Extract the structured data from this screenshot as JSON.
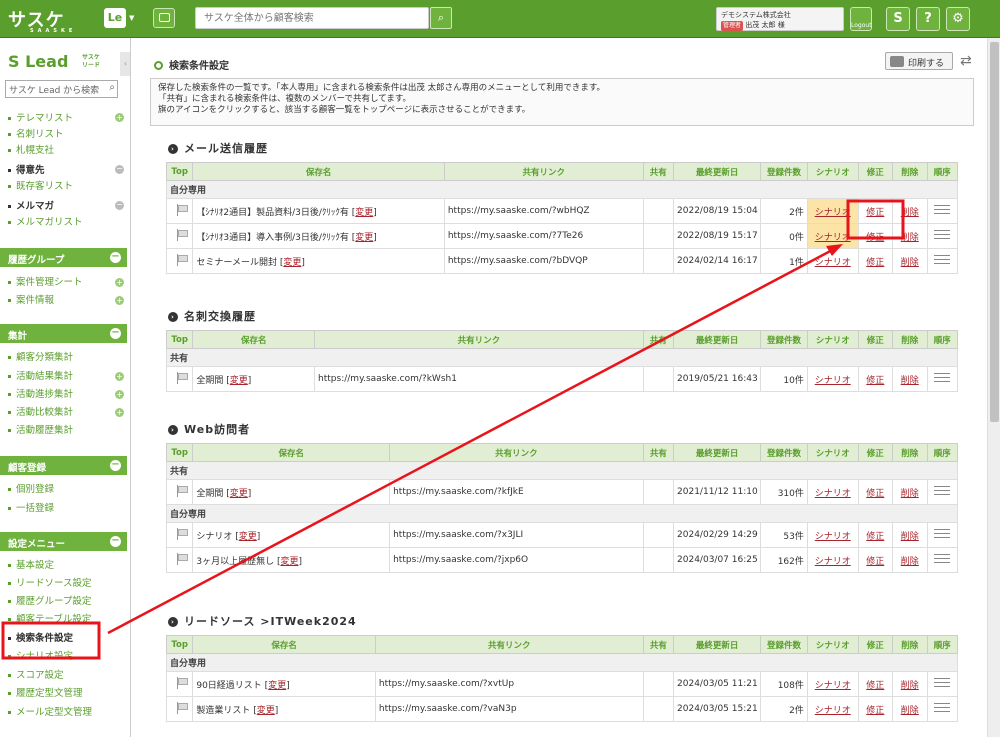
{
  "topbar": {
    "logo": "サスケ",
    "logo_sub": "SAASKE",
    "app_badge": "Le",
    "search_placeholder": "サスケ全体から顧客検索",
    "company": "デモシステム株式会社",
    "user_role": "管理者",
    "user_name": "出茂 太郎 様",
    "logout": "Logout",
    "icon_s": "S",
    "icon_help": "?",
    "icon_settings": "⚙"
  },
  "sidebar": {
    "logo": "Lead",
    "logo_sub": "サスケ リード",
    "search_placeholder": "サスケ Lead から検索",
    "items_top": [
      "テレマリスト",
      "名刺リスト",
      "札幌支社"
    ],
    "group_customers": "得意先",
    "item_existing": "既存客リスト",
    "group_mailmaga": "メルマガ",
    "item_mailmaga_list": "メルマガリスト",
    "head_history": "履歴グループ",
    "history_items": [
      "案件管理シート",
      "案件情報"
    ],
    "head_stats": "集計",
    "stats_items": [
      "顧客分類集計",
      "活動結果集計",
      "活動進捗集計",
      "活動比較集計",
      "活動履歴集計"
    ],
    "head_register": "顧客登録",
    "register_items": [
      "個別登録",
      "一括登録"
    ],
    "head_settings": "設定メニュー",
    "settings_items": [
      "基本設定",
      "リードソース設定",
      "履歴グループ設定",
      "顧客テーブル設定",
      "検索条件設定",
      "シナリオ設定",
      "スコア設定",
      "履歴定型文管理",
      "メール定型文管理"
    ]
  },
  "main": {
    "title": "検索条件設定",
    "print_label": "印刷する",
    "desc_lines": [
      "保存した検索条件の一覧です。「本人専用」に含まれる検索条件は出茂 太郎さん専用のメニューとして利用できます。",
      "「共有」に含まれる検索条件は、複数のメンバーで共有してます。",
      "旗のアイコンをクリックすると、該当する顧客一覧をトップページに表示させることができます。"
    ]
  },
  "columns": {
    "top": "Top",
    "name": "保存名",
    "link": "共有リンク",
    "share": "共有",
    "updated": "最終更新日",
    "count": "登録件数",
    "scenario": "シナリオ",
    "edit": "修正",
    "delete": "削除",
    "order": "順序"
  },
  "row_labels": {
    "change": "変更",
    "scenario": "シナリオ",
    "edit": "修正",
    "delete": "削除"
  },
  "sections": [
    {
      "title": "メール送信履歴",
      "groups": [
        {
          "label": "自分専用",
          "rows": [
            {
              "name": "【ｼﾅﾘｵ2通目】製品資料/3日後/ｸﾘｯｸ有",
              "link": "https://my.saaske.com/?wbHQZ",
              "updated": "2022/08/19 15:04",
              "count": "2件",
              "highlight": true
            },
            {
              "name": "【ｼﾅﾘｵ3通目】導入事例/3日後/ｸﾘｯｸ有",
              "link": "https://my.saaske.com/?7Te26",
              "updated": "2022/08/19 15:17",
              "count": "0件",
              "highlight": true
            },
            {
              "name": "セミナーメール開封",
              "link": "https://my.saaske.com/?bDVQP",
              "updated": "2024/02/14 16:17",
              "count": "1件",
              "highlight": false
            }
          ]
        }
      ]
    },
    {
      "title": "名刺交換履歴",
      "groups": [
        {
          "label": "共有",
          "rows": [
            {
              "name": "全期間",
              "link": "https://my.saaske.com/?kWsh1",
              "updated": "2019/05/21 16:43",
              "count": "10件",
              "highlight": false
            }
          ]
        }
      ]
    },
    {
      "title": "Web訪問者",
      "groups": [
        {
          "label": "共有",
          "rows": [
            {
              "name": "全期間",
              "link": "https://my.saaske.com/?kfJkE",
              "updated": "2021/11/12 11:10",
              "count": "310件",
              "highlight": false
            }
          ]
        },
        {
          "label": "自分専用",
          "rows": [
            {
              "name": "シナリオ",
              "link": "https://my.saaske.com/?x3JLI",
              "updated": "2024/02/29 14:29",
              "count": "53件",
              "highlight": false
            },
            {
              "name": "3ヶ月以上履歴無し",
              "link": "https://my.saaske.com/?jxp6O",
              "updated": "2024/03/07 16:25",
              "count": "162件",
              "highlight": false
            }
          ]
        }
      ]
    },
    {
      "title": "リードソース >ITWeek2024",
      "groups": [
        {
          "label": "自分専用",
          "rows": [
            {
              "name": "90日経過リスト",
              "link": "https://my.saaske.com/?xvtUp",
              "updated": "2024/03/05 11:21",
              "count": "108件",
              "highlight": false
            },
            {
              "name": "製造業リスト",
              "link": "https://my.saaske.com/?vaN3p",
              "updated": "2024/03/05 15:21",
              "count": "2件",
              "highlight": false
            }
          ]
        }
      ]
    }
  ],
  "colors": {
    "brand_green": "#5a9e2d",
    "link_red": "#a8232b",
    "highlight": "#fbe4a6",
    "annotation_red": "#e8141c"
  }
}
